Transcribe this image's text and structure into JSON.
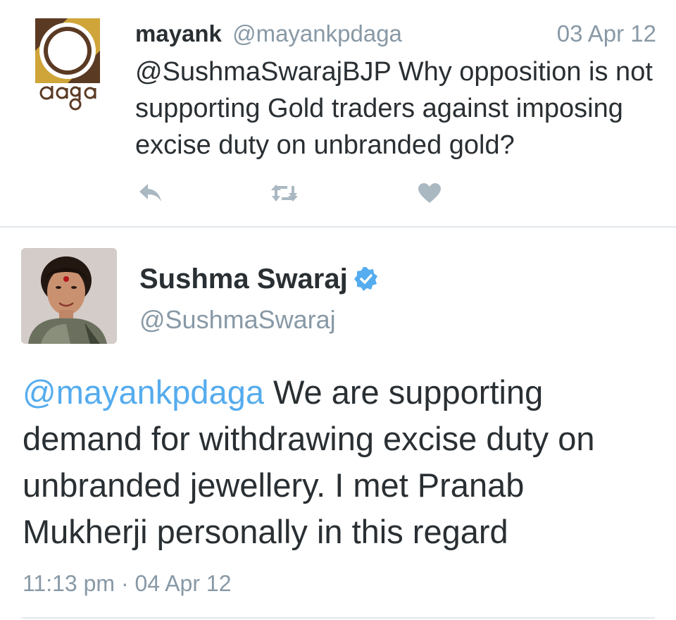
{
  "reply_tweet": {
    "author_name": "mayank",
    "author_handle": "@mayankpdaga",
    "date": "03 Apr 12",
    "mention": "@SushmaSwarajBJP",
    "text": " Why opposition is not supporting Gold traders against imposing excise duty on unbranded gold?",
    "logo_text": "Daga",
    "icons": [
      "reply-icon",
      "retweet-icon",
      "like-icon"
    ]
  },
  "main_tweet": {
    "author_name": "Sushma Swaraj",
    "author_handle": "@SushmaSwaraj",
    "verified": true,
    "mention": "@mayankpdaga",
    "text": " We are supporting demand for withdrawing excise duty on unbranded jewellery. I met Pranab Mukherji personally in this regard",
    "timestamp": "11:13 pm · 04 Apr 12"
  },
  "colors": {
    "link": "#55acee",
    "secondary_text": "#8899a6",
    "primary_text": "#292f33",
    "logo_gold": "#cfa53a",
    "logo_brown": "#5b3a24"
  }
}
